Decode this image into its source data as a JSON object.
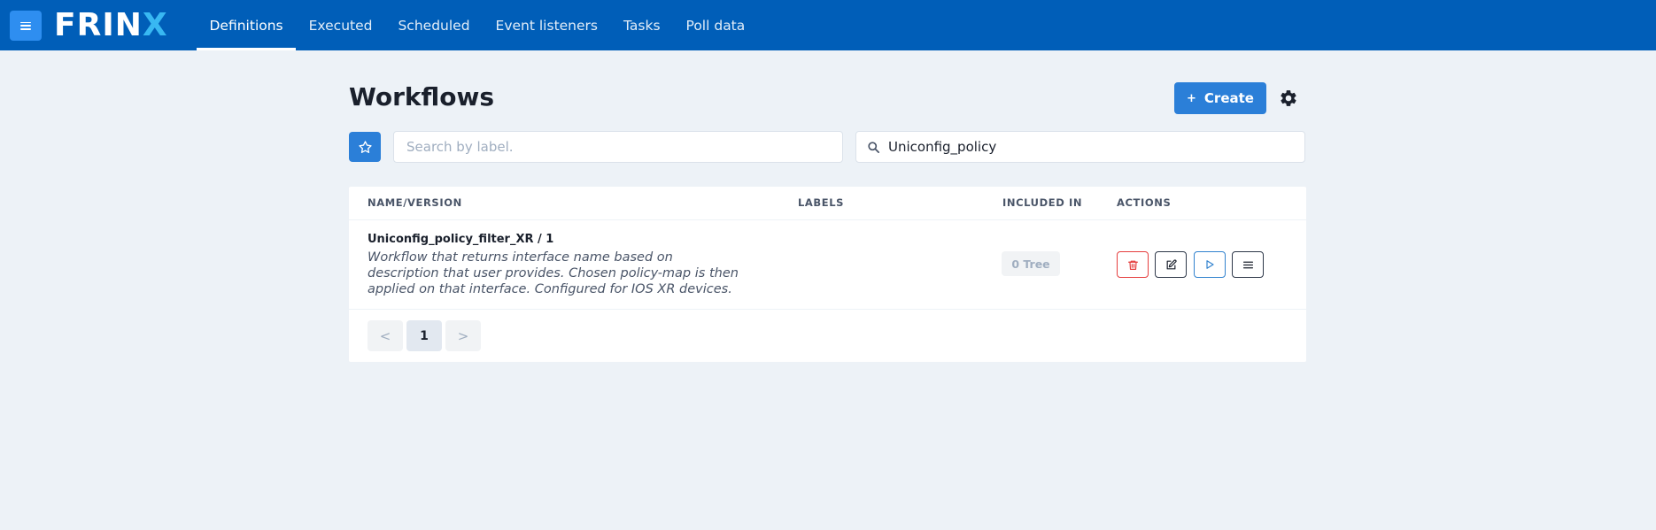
{
  "app": {
    "logo_main": "FRIN",
    "logo_accent": "X"
  },
  "nav": {
    "tabs": [
      {
        "label": "Definitions",
        "active": true
      },
      {
        "label": "Executed",
        "active": false
      },
      {
        "label": "Scheduled",
        "active": false
      },
      {
        "label": "Event listeners",
        "active": false
      },
      {
        "label": "Tasks",
        "active": false
      },
      {
        "label": "Poll data",
        "active": false
      }
    ]
  },
  "header": {
    "title": "Workflows",
    "create_label": "Create",
    "create_icon": "+"
  },
  "search": {
    "label_placeholder": "Search by label.",
    "name_value": "Uniconfig_policy"
  },
  "table": {
    "columns": [
      "NAME/VERSION",
      "LABELS",
      "INCLUDED IN",
      "ACTIONS"
    ],
    "rows": [
      {
        "name": "Uniconfig_policy_filter_XR / 1",
        "description": "Workflow that returns interface name based on description that user provides. Chosen policy-map is then applied on that interface. Configured for IOS XR devices.",
        "labels": "",
        "included_in": "0 Tree"
      }
    ]
  },
  "pagination": {
    "prev": "<",
    "current": "1",
    "next": ">"
  },
  "colors": {
    "topbar": "#005eb8",
    "primary": "#2b7fd8",
    "danger": "#e53e3e",
    "background": "#edf2f7"
  }
}
